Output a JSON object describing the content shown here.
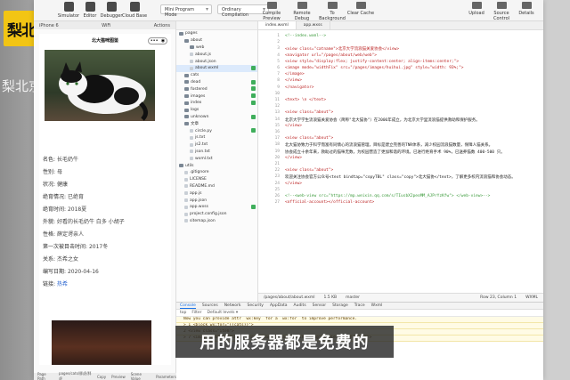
{
  "channel": {
    "logo": "梨北京",
    "watermark": "梨北京"
  },
  "toolbar": {
    "buttons": [
      {
        "label": "Simulator"
      },
      {
        "label": "Editor"
      },
      {
        "label": "Debugger"
      },
      {
        "label": "Cloud Base"
      }
    ],
    "mode_select": "Mini Program Mode",
    "compile_select": "Ordinary Compilation",
    "actions": [
      {
        "label": "Compile Preview"
      },
      {
        "label": "Remote Debug"
      },
      {
        "label": "To Background"
      },
      {
        "label": "Clear Cache"
      }
    ],
    "right_actions": [
      {
        "label": "Upload"
      },
      {
        "label": "Source Control"
      },
      {
        "label": "Details"
      }
    ]
  },
  "simulator": {
    "device_bar": [
      "iPhone 6",
      "WiFi",
      "Actions"
    ],
    "page_title": "北大猫咪图鉴",
    "info": [
      {
        "key": "名色:",
        "value": "长毛奶牛",
        "link": false
      },
      {
        "key": "性别:",
        "value": "母",
        "link": false
      },
      {
        "key": "状况:",
        "value": "健康",
        "link": false
      },
      {
        "key": "绝育情况:",
        "value": "已绝育",
        "link": false
      },
      {
        "key": "绝育时间:",
        "value": "2018夏",
        "link": false
      },
      {
        "key": "外貌:",
        "value": "好看的长毛奶牛 白多 小胡子",
        "link": false
      },
      {
        "key": "性格:",
        "value": "薛定谔亲人",
        "link": false
      },
      {
        "key": "第一次被目击时间:",
        "value": "2017冬",
        "link": false
      },
      {
        "key": "关系:",
        "value": "杰希之女",
        "link": false
      },
      {
        "key": "编写日期:",
        "value": "2020-04-16",
        "link": false
      },
      {
        "key": "链接:",
        "value": "热希",
        "link": true
      }
    ],
    "footer": [
      "Page Path",
      "pages/cats/胖虎/胖虎",
      "Copy",
      "Preview",
      "Scene Value",
      "Parameters"
    ]
  },
  "file_tree": [
    {
      "label": "pages",
      "kind": "folder",
      "depth": 0
    },
    {
      "label": "about",
      "kind": "folder",
      "depth": 1
    },
    {
      "label": "web",
      "kind": "folder",
      "depth": 2
    },
    {
      "label": "about.js",
      "kind": "file",
      "depth": 2
    },
    {
      "label": "about.json",
      "kind": "file",
      "depth": 2
    },
    {
      "label": "about.wxml",
      "kind": "file",
      "depth": 2,
      "selected": true,
      "ok": true
    },
    {
      "label": "cats",
      "kind": "folder",
      "depth": 1
    },
    {
      "label": "dead",
      "kind": "folder",
      "depth": 1,
      "ok": true
    },
    {
      "label": "fostered",
      "kind": "folder",
      "depth": 1,
      "ok": true
    },
    {
      "label": "images",
      "kind": "folder",
      "depth": 1,
      "ok": true
    },
    {
      "label": "index",
      "kind": "folder",
      "depth": 1,
      "ok": true
    },
    {
      "label": "logs",
      "kind": "folder",
      "depth": 1
    },
    {
      "label": "unknown",
      "kind": "folder",
      "depth": 1,
      "ok": true
    },
    {
      "label": "文章",
      "kind": "folder",
      "depth": 1
    },
    {
      "label": "circle.py",
      "kind": "file",
      "depth": 2,
      "ok": true
    },
    {
      "label": "js.txt",
      "kind": "file",
      "depth": 2
    },
    {
      "label": "js2.txt",
      "kind": "file",
      "depth": 2
    },
    {
      "label": "json.txt",
      "kind": "file",
      "depth": 2
    },
    {
      "label": "wxml.txt",
      "kind": "file",
      "depth": 2
    },
    {
      "label": "utils",
      "kind": "folder",
      "depth": 0
    },
    {
      "label": ".gitignore",
      "kind": "file",
      "depth": 1
    },
    {
      "label": "LICENSE",
      "kind": "file",
      "depth": 1
    },
    {
      "label": "README.md",
      "kind": "file",
      "depth": 1
    },
    {
      "label": "app.js",
      "kind": "file",
      "depth": 1
    },
    {
      "label": "app.json",
      "kind": "file",
      "depth": 1
    },
    {
      "label": "app.wxss",
      "kind": "file",
      "depth": 1,
      "ok": true
    },
    {
      "label": "project.config.json",
      "kind": "file",
      "depth": 1
    },
    {
      "label": "sitemap.json",
      "kind": "file",
      "depth": 1
    }
  ],
  "editor": {
    "tabs": [
      "index.wxml",
      "app.wxss"
    ],
    "lines": [
      {
        "n": "1",
        "text": "<!--index.wxml-->",
        "cls": "cmt"
      },
      {
        "n": "2",
        "text": "",
        "cls": "txt"
      },
      {
        "n": "3",
        "text": "<view class=\"catname\">北京大学流浪猫关爱协会</view>",
        "cls": "tag"
      },
      {
        "n": "4",
        "text": "<navigator url=\"/pages/about/web/web\">",
        "cls": "tag"
      },
      {
        "n": "5",
        "text": "<view style=\"display:flex; justify-content:center; align-items:center;\">",
        "cls": "tag"
      },
      {
        "n": "6",
        "text": "  <image mode=\"widthFix\" src=\"/pages/images/huihui.jpg\" style=\"width: 93%;\">",
        "cls": "tag"
      },
      {
        "n": "7",
        "text": "  </image>",
        "cls": "tag"
      },
      {
        "n": "8",
        "text": "</view>",
        "cls": "tag"
      },
      {
        "n": "9",
        "text": "</navigator>",
        "cls": "tag"
      },
      {
        "n": "10",
        "text": "",
        "cls": "txt"
      },
      {
        "n": "11",
        "text": "<text> \\n </text>",
        "cls": "tag"
      },
      {
        "n": "12",
        "text": "",
        "cls": "txt"
      },
      {
        "n": "13",
        "text": "<view class=\"about\">",
        "cls": "tag"
      },
      {
        "n": "14",
        "text": "北京大学学生流浪猫关爱协会（简称\"北大猫协\"）在2006年成立，为北京大学里流浪猫提供救助和保护服务。",
        "cls": "txt"
      },
      {
        "n": "15",
        "text": "</view>",
        "cls": "tag"
      },
      {
        "n": "16",
        "text": "",
        "cls": "txt"
      },
      {
        "n": "17",
        "text": "<view class=\"about\">",
        "cls": "tag"
      },
      {
        "n": "18",
        "text": "北大猫协致力于科学而富有同情心的流浪猫管理，目标是建立完善的TNR体系，减少校园流浪猫数量，保障人猫关系。",
        "cls": "txt"
      },
      {
        "n": "19",
        "text": "协会成立十余年来，救助过的猫咪无数，为校园营造了更加和谐的环境。已进行绝育手术 90%，已送养猫数 400-500 只。",
        "cls": "txt"
      },
      {
        "n": "20",
        "text": "</view>",
        "cls": "tag"
      },
      {
        "n": "21",
        "text": "",
        "cls": "txt"
      },
      {
        "n": "22",
        "text": "<view class=\"about\">",
        "cls": "tag"
      },
      {
        "n": "23",
        "text": "欢迎关注协会官方公众号<text bindtap=\"copyTBL\" class=\"copy\">北大猫协</text>，了解更多校内流浪猫和协会动态。",
        "cls": "txt"
      },
      {
        "n": "24",
        "text": "</view>",
        "cls": "tag"
      },
      {
        "n": "25",
        "text": "",
        "cls": "txt"
      },
      {
        "n": "26",
        "text": "<!--<web-view src=\"https://mp.weixin.qq.com/s/TIusbX2peoMM_AJPrYzKfw\"> </web-view>-->",
        "cls": "cmt"
      },
      {
        "n": "27",
        "text": "<official-account></official-account>",
        "cls": "tag"
      }
    ],
    "status_path": "/pages/about/about.wxml",
    "status_size": "1.5 KB",
    "status_branch": "master",
    "status_pos": "Row 23, Column 1",
    "status_lang": "WXML"
  },
  "console": {
    "tabs": [
      "Console",
      "Sources",
      "Network",
      "Security",
      "AppData",
      "Audits",
      "Sensor",
      "Storage",
      "Trace",
      "Wxml"
    ],
    "active_tab": "Console",
    "filter_top": "top",
    "filter_placeholder": "Filter",
    "filter_levels": "Default levels ▾",
    "warnings": [
      "Now you can provide attr `wx:key` for a `wx:for` to improve performance.",
      "> 1 <block wx:for=\"{{cats}}\">",
      "  2   <view class=\"item\">",
      "> 7   <image mode=\"widthFix\" src=\"/pages/images/huihui.jpg\" style=\"width: 93%;\">"
    ]
  },
  "subtitle": "用的服务器都是免费的"
}
